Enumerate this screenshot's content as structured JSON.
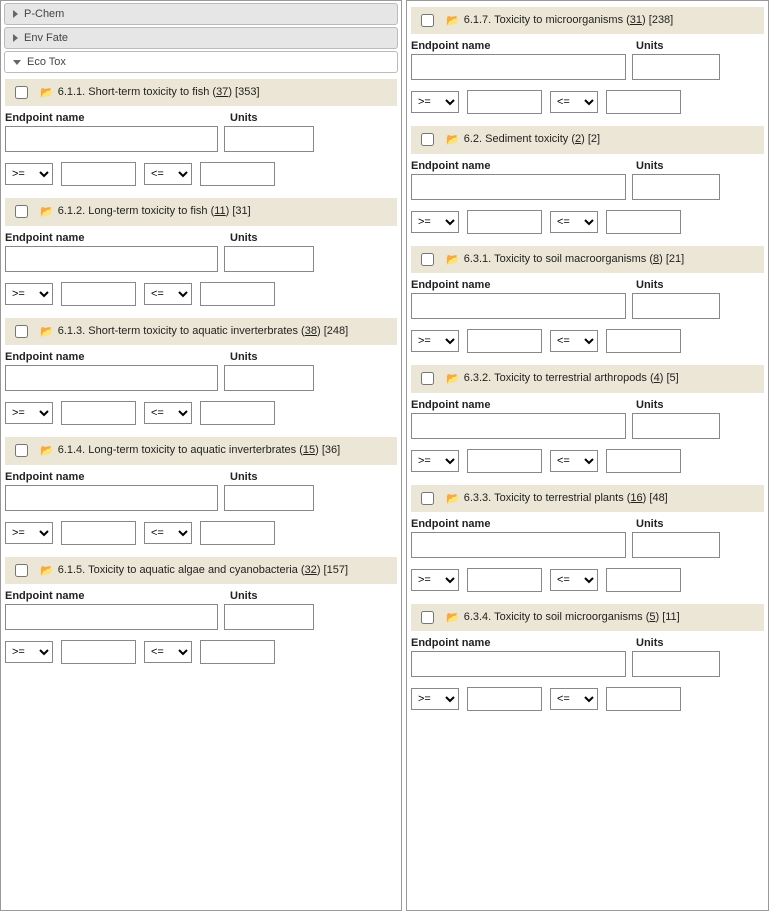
{
  "accordion": {
    "pchem": "P-Chem",
    "envfate": "Env Fate",
    "ecotox": "Eco Tox"
  },
  "labels": {
    "endpoint": "Endpoint name",
    "units": "Units",
    "gte": ">=",
    "lte": "<="
  },
  "left_sections": [
    {
      "num": "6.1.1.",
      "title_a": "Short-term toxicity to fish (",
      "link": "37",
      "title_b": ") [353]"
    },
    {
      "num": "6.1.2.",
      "title_a": "Long-term toxicity to fish (",
      "link": "11",
      "title_b": ") [31]"
    },
    {
      "num": "6.1.3.",
      "title_a": "Short-term toxicity to aquatic inverterbrates (",
      "link": "38",
      "title_b": ") [248]"
    },
    {
      "num": "6.1.4.",
      "title_a": "Long-term toxicity to aquatic inverterbrates (",
      "link": "15",
      "title_b": ") [36]"
    },
    {
      "num": "6.1.5.",
      "title_a": "Toxicity to aquatic algae and cyanobacteria (",
      "link": "32",
      "title_b": ") [157]"
    }
  ],
  "right_sections": [
    {
      "num": "6.1.7.",
      "title_a": "Toxicity to microorganisms (",
      "link": "31",
      "title_b": ") [238]"
    },
    {
      "num": "6.2.",
      "title_a": "Sediment toxicity (",
      "link": "2",
      "title_b": ") [2]"
    },
    {
      "num": "6.3.1.",
      "title_a": "Toxicity to soil macroorganisms (",
      "link": "8",
      "title_b": ") [21]"
    },
    {
      "num": "6.3.2.",
      "title_a": "Toxicity to terrestrial arthropods (",
      "link": "4",
      "title_b": ") [5]"
    },
    {
      "num": "6.3.3.",
      "title_a": "Toxicity to terrestrial plants (",
      "link": "16",
      "title_b": ") [48]"
    },
    {
      "num": "6.3.4.",
      "title_a": "Toxicity to soil microorganisms (",
      "link": "5",
      "title_b": ") [11]"
    }
  ]
}
